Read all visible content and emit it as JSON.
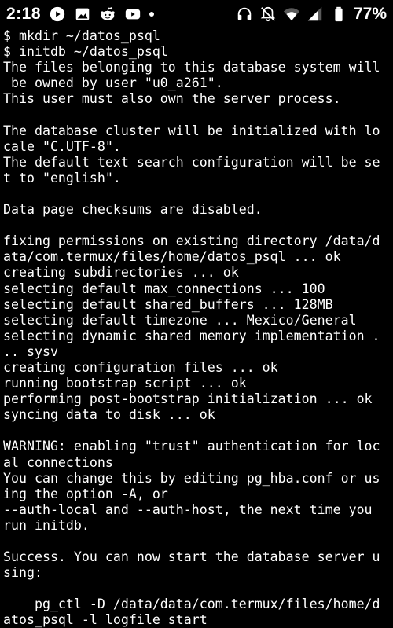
{
  "status_bar": {
    "time": "2:18",
    "battery_percent": "77%",
    "left_icons": [
      "play-circle-icon",
      "image-icon",
      "reddit-icon",
      "youtube-icon",
      "dot-icon"
    ],
    "right_icons": [
      "headphones-icon",
      "bell-off-icon",
      "wifi-icon",
      "signal-icon",
      "battery-icon"
    ]
  },
  "terminal": {
    "lines": [
      "$ mkdir ~/datos_psql",
      "$ initdb ~/datos_psql",
      "The files belonging to this database system will",
      " be owned by user \"u0_a261\".",
      "This user must also own the server process.",
      "",
      "The database cluster will be initialized with lo",
      "cale \"C.UTF-8\".",
      "The default text search configuration will be se",
      "t to \"english\".",
      "",
      "Data page checksums are disabled.",
      "",
      "fixing permissions on existing directory /data/d",
      "ata/com.termux/files/home/datos_psql ... ok",
      "creating subdirectories ... ok",
      "selecting default max_connections ... 100",
      "selecting default shared_buffers ... 128MB",
      "selecting default timezone ... Mexico/General",
      "selecting dynamic shared memory implementation .",
      ".. sysv",
      "creating configuration files ... ok",
      "running bootstrap script ... ok",
      "performing post-bootstrap initialization ... ok",
      "syncing data to disk ... ok",
      "",
      "WARNING: enabling \"trust\" authentication for loc",
      "al connections",
      "You can change this by editing pg_hba.conf or us",
      "ing the option -A, or",
      "--auth-local and --auth-host, the next time you",
      "run initdb.",
      "",
      "Success. You can now start the database server u",
      "sing:",
      "",
      "    pg_ctl -D /data/data/com.termux/files/home/d",
      "atos_psql -l logfile start"
    ]
  }
}
